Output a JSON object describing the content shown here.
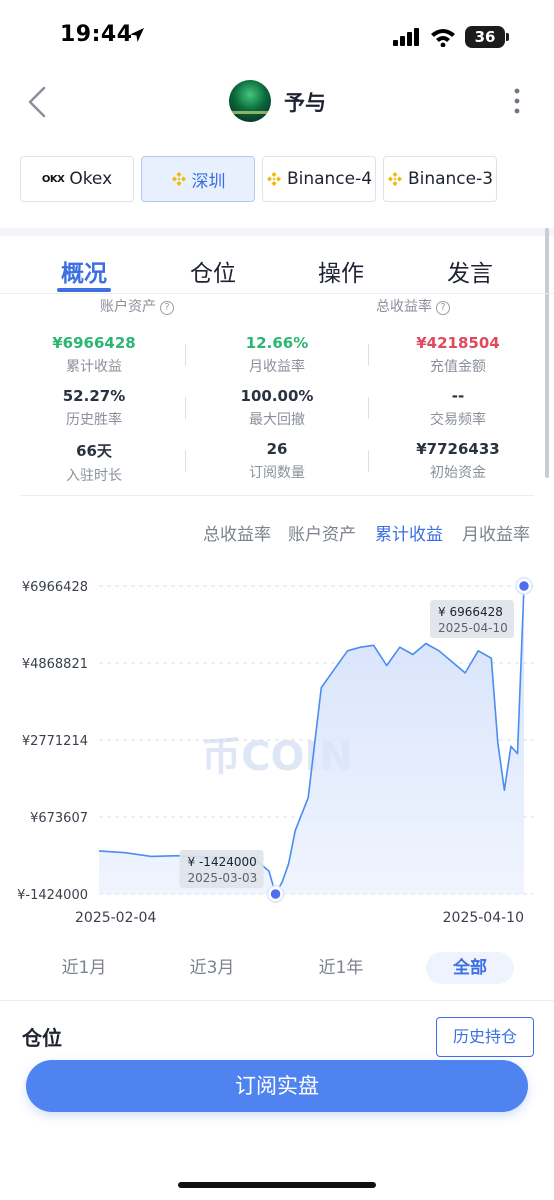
{
  "status_bar": {
    "time": "19:44",
    "battery": "36"
  },
  "header": {
    "title": "予与"
  },
  "exchanges": [
    {
      "label": "Okex",
      "logo": "OKX"
    },
    {
      "label": "深圳",
      "active": true
    },
    {
      "label": "Binance-4"
    },
    {
      "label": "Binance-3"
    }
  ],
  "tabs": [
    "概况",
    "仓位",
    "操作",
    "发言"
  ],
  "stats_header": {
    "left": "账户资产",
    "right": "总收益率"
  },
  "stats": [
    {
      "value": "¥6966428",
      "label": "累计收益",
      "color": "#2bb673"
    },
    {
      "value": "12.66%",
      "label": "月收益率",
      "color": "#2bb673"
    },
    {
      "value": "¥4218504",
      "label": "充值金额",
      "color": "#e04a5a"
    },
    {
      "value": "52.27%",
      "label": "历史胜率"
    },
    {
      "value": "100.00%",
      "label": "最大回撤"
    },
    {
      "value": "--",
      "label": "交易频率"
    },
    {
      "value": "66天",
      "label": "入驻时长"
    },
    {
      "value": "26",
      "label": "订阅数量"
    },
    {
      "value": "¥7726433",
      "label": "初始资金"
    }
  ],
  "chart_tabs": [
    "总收益率",
    "账户资产",
    "累计收益",
    "月收益率"
  ],
  "range_buttons": [
    "近1月",
    "近3月",
    "近1年",
    "全部"
  ],
  "positions": {
    "title": "仓位",
    "history_button": "历史持仓"
  },
  "subscribe_button": "订阅实盘",
  "colors": {
    "accent": "#3b6fe3",
    "positive": "#2bb673",
    "negative": "#e04a5a"
  },
  "chart_data": {
    "type": "area",
    "title": "",
    "xlabel": "",
    "ylabel": "",
    "y_ticks": [
      "¥6966428",
      "¥4868821",
      "¥2771214",
      "¥673607",
      "¥-1424000"
    ],
    "x_ticks": [
      "2025-02-04",
      "2025-04-10"
    ],
    "ylim": [
      -1424000,
      6966428
    ],
    "watermark": "币COIN",
    "x": [
      "2025-02-04",
      "2025-02-08",
      "2025-02-12",
      "2025-02-16",
      "2025-02-20",
      "2025-02-24",
      "2025-02-28",
      "2025-03-02",
      "2025-03-03",
      "2025-03-04",
      "2025-03-05",
      "2025-03-06",
      "2025-03-08",
      "2025-03-10",
      "2025-03-12",
      "2025-03-14",
      "2025-03-16",
      "2025-03-18",
      "2025-03-20",
      "2025-03-22",
      "2025-03-24",
      "2025-03-26",
      "2025-03-28",
      "2025-03-30",
      "2025-04-01",
      "2025-04-03",
      "2025-04-05",
      "2025-04-06",
      "2025-04-07",
      "2025-04-08",
      "2025-04-09",
      "2025-04-10"
    ],
    "values": [
      -250000,
      -300000,
      -400000,
      -380000,
      -420000,
      -430000,
      -500000,
      -800000,
      -1424000,
      -1100000,
      -600000,
      300000,
      1200000,
      4200000,
      4700000,
      5200000,
      5300000,
      5350000,
      4800000,
      5300000,
      5100000,
      5400000,
      5200000,
      4900000,
      4600000,
      5200000,
      5000000,
      2700000,
      1400000,
      2600000,
      2400000,
      6966428
    ],
    "annotations": [
      {
        "x": "2025-04-10",
        "y": 6966428,
        "label": "¥ 6966428",
        "date": "2025-04-10"
      },
      {
        "x": "2025-03-03",
        "y": -1424000,
        "label": "¥ -1424000",
        "date": "2025-03-03"
      }
    ]
  }
}
